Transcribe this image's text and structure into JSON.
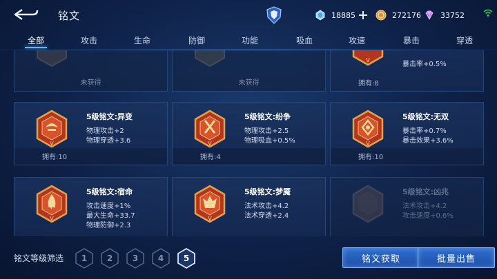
{
  "header": {
    "title": "铭文",
    "currencies": [
      {
        "icon": "diamond-icon",
        "value": "18885"
      },
      {
        "icon": "gold-coin-icon",
        "value": "272176"
      },
      {
        "icon": "gem-icon",
        "value": "33752"
      }
    ]
  },
  "tabs": [
    "全部",
    "攻击",
    "生命",
    "防御",
    "功能",
    "吸血",
    "攻速",
    "暴击",
    "穿透"
  ],
  "active_tab": "全部",
  "top_row": [
    {
      "status": "未获得"
    },
    {
      "status": "未获得"
    },
    {
      "stat": "暴击率+0.5%",
      "owned": "拥有:8"
    }
  ],
  "cards": [
    {
      "title": "5级铭文:异变",
      "stats": [
        "物理攻击+2",
        "物理穿透+3.6"
      ],
      "owned": "拥有:10"
    },
    {
      "title": "5级铭文:纷争",
      "stats": [
        "物理攻击+2.5",
        "物理吸血+0.5%"
      ],
      "owned": "拥有:4"
    },
    {
      "title": "5级铭文:无双",
      "stats": [
        "暴击率+0.7%",
        "暴击效果+3.6%"
      ],
      "owned": "拥有:10"
    },
    {
      "title": "5级铭文:宿命",
      "stats": [
        "攻击速度+1%",
        "最大生命+33.7",
        "物理防御+2.3"
      ],
      "owned": ""
    },
    {
      "title": "5级铭文:梦魇",
      "stats": [
        "法术攻击+4.2",
        "法术穿透+2.4"
      ],
      "owned": ""
    },
    {
      "title": "5级铭文:凶兆",
      "stats": [
        "法术攻击+4.2",
        "攻击速度+0.6%"
      ],
      "owned": ""
    }
  ],
  "footer": {
    "filter_label": "铭文等级筛选",
    "levels": [
      "1",
      "2",
      "3",
      "4",
      "5"
    ],
    "active_level": "5",
    "get_button": "铭文获取",
    "sell_button": "批量出售"
  },
  "colors": {
    "accent": "#5fb7ff",
    "button": "#2f6fd0",
    "rune_gold": "#e0a24a",
    "rune_red": "#b4351f"
  }
}
